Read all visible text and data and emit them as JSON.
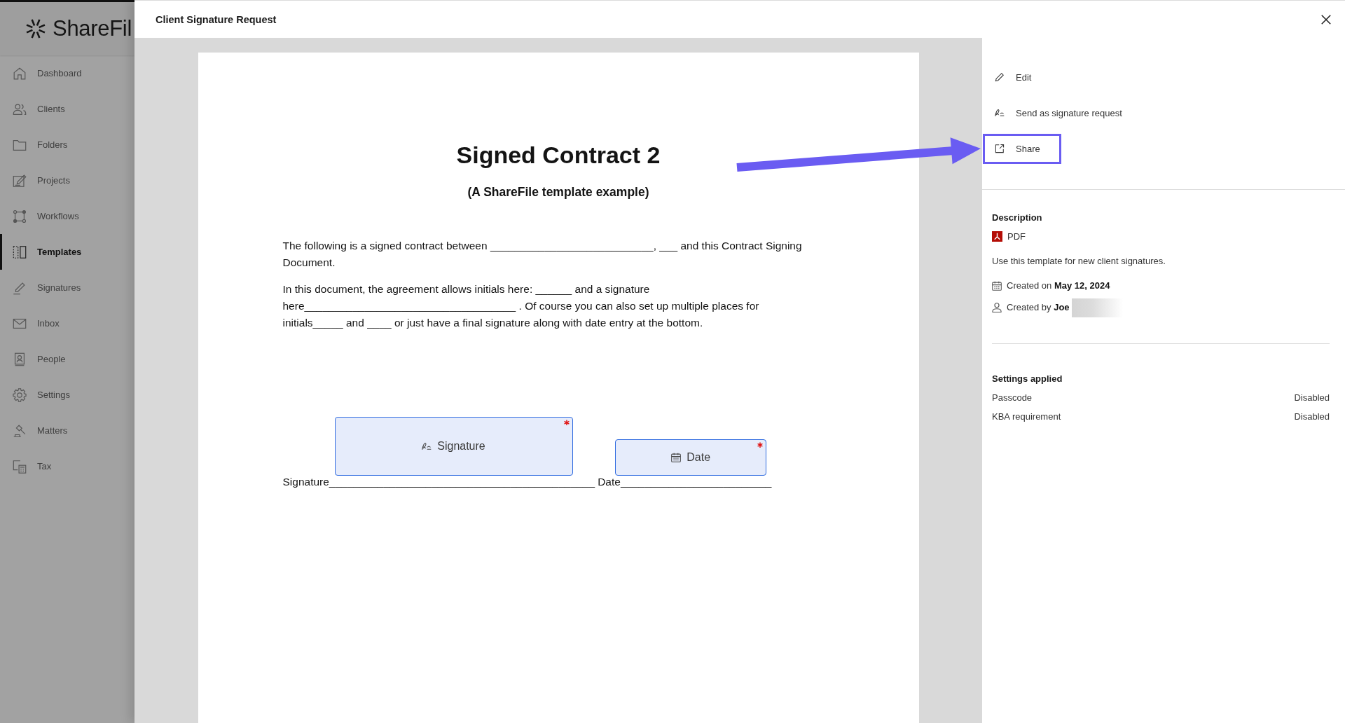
{
  "sidebar": {
    "logo": {
      "text": "ShareFil"
    },
    "items": [
      {
        "label": "Dashboard",
        "selected": false
      },
      {
        "label": "Clients",
        "selected": false
      },
      {
        "label": "Folders",
        "selected": false
      },
      {
        "label": "Projects",
        "selected": false
      },
      {
        "label": "Workflows",
        "selected": false
      },
      {
        "label": "Templates",
        "selected": true
      },
      {
        "label": "Signatures",
        "selected": false
      },
      {
        "label": "Inbox",
        "selected": false
      },
      {
        "label": "People",
        "selected": false
      },
      {
        "label": "Settings",
        "selected": false
      },
      {
        "label": "Matters",
        "selected": false
      },
      {
        "label": "Tax",
        "selected": false
      }
    ]
  },
  "dialog": {
    "title": "Client Signature Request",
    "document": {
      "title": "Signed Contract 2",
      "subtitle": "(A ShareFile template example)",
      "paragraphs": [
        "The following is a signed contract between ___________________________, ___ and this Contract Signing Document.",
        "In this document, the agreement allows initials here: ______ and a signature here___________________________________ . Of course you can also set up multiple places for initials_____ and ____ or just have a final signature along with date entry at the bottom."
      ],
      "blanks": [
        {
          "kind": "signature",
          "text": "Signature____________________________________________",
          "field": {
            "label": "Signature",
            "required": true
          }
        },
        {
          "kind": "date",
          "text": "Date_________________________",
          "field": {
            "label": "Date",
            "required": true
          }
        }
      ]
    },
    "actions": [
      {
        "label": "Edit",
        "highlighted": false
      },
      {
        "label": "Send as signature request",
        "highlighted": false
      },
      {
        "label": "Share",
        "highlighted": true
      }
    ],
    "details": {
      "heading": "Description",
      "file_type": "PDF",
      "description": "Use this template for new client signatures.",
      "created_on": "Created on **May 12, 2024**",
      "created_by": {
        "text": "Created by **Joe**",
        "redacted": true
      }
    },
    "settings": {
      "heading": "Settings applied",
      "rows": [
        {
          "label": "Passcode",
          "value": "Disabled"
        },
        {
          "label": "KBA requirement",
          "value": "Disabled"
        }
      ]
    }
  }
}
